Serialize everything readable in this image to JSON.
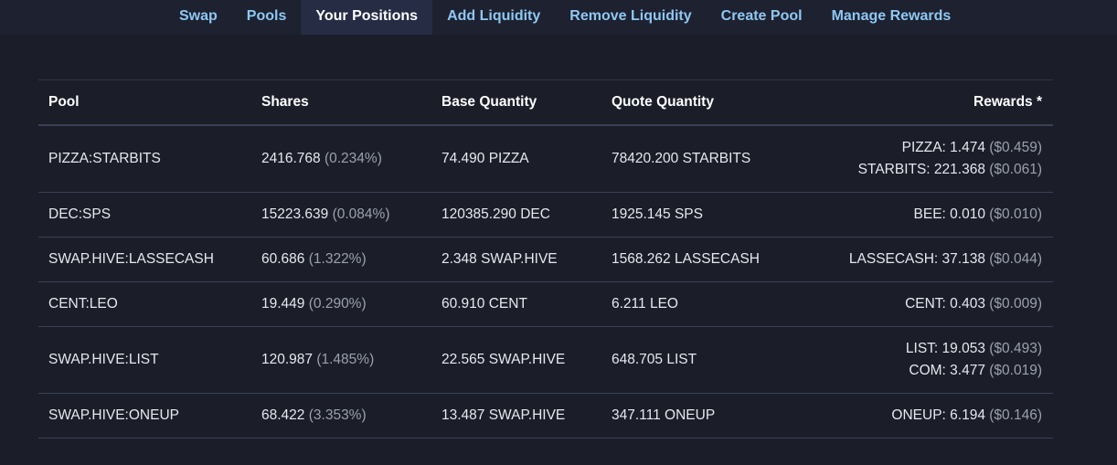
{
  "nav": {
    "tabs": [
      {
        "label": "Swap"
      },
      {
        "label": "Pools"
      },
      {
        "label": "Your Positions",
        "active": true
      },
      {
        "label": "Add Liquidity"
      },
      {
        "label": "Remove Liquidity"
      },
      {
        "label": "Create Pool"
      },
      {
        "label": "Manage Rewards"
      }
    ]
  },
  "table": {
    "headers": {
      "pool": "Pool",
      "shares": "Shares",
      "base": "Base Quantity",
      "quote": "Quote Quantity",
      "rewards": "Rewards *"
    },
    "rows": [
      {
        "pool": "PIZZA:STARBITS",
        "shares": "2416.768",
        "share_pct": "(0.234%)",
        "base": "74.490 PIZZA",
        "quote": "78420.200 STARBITS",
        "rewards": [
          {
            "amount": "PIZZA: 1.474",
            "usd": "($0.459)"
          },
          {
            "amount": "STARBITS: 221.368",
            "usd": "($0.061)"
          }
        ]
      },
      {
        "pool": "DEC:SPS",
        "shares": "15223.639",
        "share_pct": "(0.084%)",
        "base": "120385.290 DEC",
        "quote": "1925.145 SPS",
        "rewards": [
          {
            "amount": "BEE: 0.010",
            "usd": "($0.010)"
          }
        ]
      },
      {
        "pool": "SWAP.HIVE:LASSECASH",
        "shares": "60.686",
        "share_pct": "(1.322%)",
        "base": "2.348 SWAP.HIVE",
        "quote": "1568.262 LASSECASH",
        "rewards": [
          {
            "amount": "LASSECASH: 37.138",
            "usd": "($0.044)"
          }
        ]
      },
      {
        "pool": "CENT:LEO",
        "shares": "19.449",
        "share_pct": "(0.290%)",
        "base": "60.910 CENT",
        "quote": "6.211 LEO",
        "rewards": [
          {
            "amount": "CENT: 0.403",
            "usd": "($0.009)"
          }
        ]
      },
      {
        "pool": "SWAP.HIVE:LIST",
        "shares": "120.987",
        "share_pct": "(1.485%)",
        "base": "22.565 SWAP.HIVE",
        "quote": "648.705 LIST",
        "rewards": [
          {
            "amount": "LIST: 19.053",
            "usd": "($0.493)"
          },
          {
            "amount": "COM: 3.477",
            "usd": "($0.019)"
          }
        ]
      },
      {
        "pool": "SWAP.HIVE:ONEUP",
        "shares": "68.422",
        "share_pct": "(3.353%)",
        "base": "13.487 SWAP.HIVE",
        "quote": "347.111 ONEUP",
        "rewards": [
          {
            "amount": "ONEUP: 6.194",
            "usd": "($0.146)"
          }
        ]
      }
    ]
  },
  "colors": {
    "background": "#1b1e29",
    "nav_link": "#8ec8f2",
    "active_tab_bg": "#252c44",
    "muted": "#9aa0ad"
  }
}
